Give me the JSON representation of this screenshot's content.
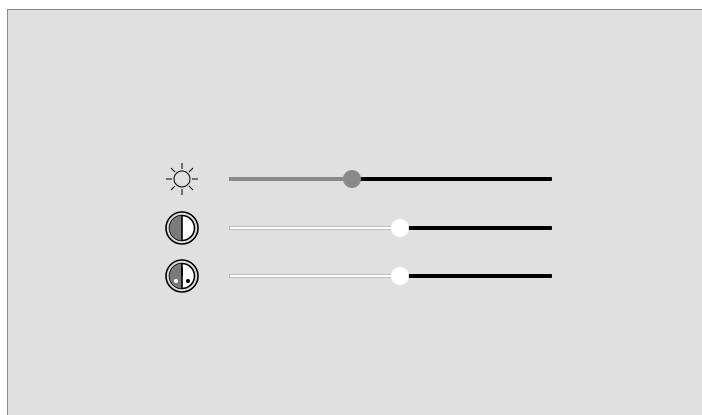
{
  "sliders": [
    {
      "id": "brightness",
      "icon": "sun-icon",
      "level": 0.38,
      "style": "gray"
    },
    {
      "id": "contrast",
      "icon": "half-circle-icon",
      "level": 0.53,
      "style": "white"
    },
    {
      "id": "color-temperature",
      "icon": "thermometer-dial-icon",
      "level": 0.53,
      "style": "white"
    }
  ],
  "colors": {
    "background": "#e0e0e0",
    "track": "#000000",
    "brightness_fill": "#8a8a8a",
    "fill_light": "#ffffff"
  }
}
